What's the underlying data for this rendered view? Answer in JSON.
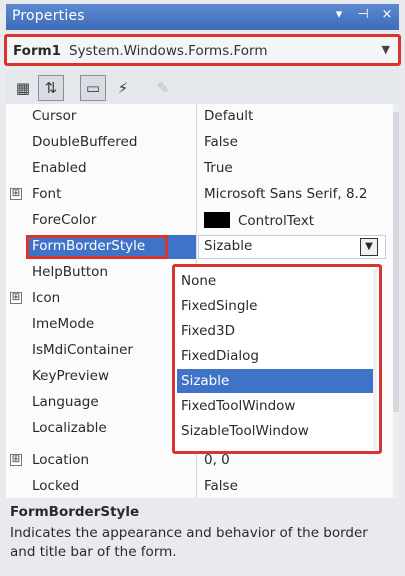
{
  "window": {
    "title": "Properties",
    "pin_glyph": "▾ ⊣ ×"
  },
  "object_selector": {
    "name": "Form1",
    "type": "System.Windows.Forms.Form"
  },
  "properties": [
    {
      "label": "Cursor",
      "value": "Default"
    },
    {
      "label": "DoubleBuffered",
      "value": "False"
    },
    {
      "label": "Enabled",
      "value": "True"
    },
    {
      "label": "Font",
      "value": "Microsoft Sans Serif, 8.2",
      "expandable": true
    },
    {
      "label": "ForeColor",
      "value": "ControlText",
      "swatch_color": "#000000"
    },
    {
      "label": "FormBorderStyle",
      "value": "Sizable",
      "selected": true
    },
    {
      "label": "HelpButton",
      "value": ""
    },
    {
      "label": "Icon",
      "value": "",
      "expandable": true
    },
    {
      "label": "ImeMode",
      "value": ""
    },
    {
      "label": "IsMdiContainer",
      "value": ""
    },
    {
      "label": "KeyPreview",
      "value": ""
    },
    {
      "label": "Language",
      "value": ""
    },
    {
      "label": "Localizable",
      "value": ""
    },
    {
      "label": "Location",
      "value": "0, 0",
      "expandable": true
    },
    {
      "label": "Locked",
      "value": "False"
    }
  ],
  "dropdown_options": [
    "None",
    "FixedSingle",
    "Fixed3D",
    "FixedDialog",
    "Sizable",
    "FixedToolWindow",
    "SizableToolWindow"
  ],
  "dropdown_selected": "Sizable",
  "description": {
    "title": "FormBorderStyle",
    "text": "Indicates the appearance and behavior of the border and title bar of the form."
  },
  "colors": {
    "accent_blue": "#3f73c8",
    "highlight_red": "#d8352f",
    "title_bar": "#4a78c2"
  }
}
